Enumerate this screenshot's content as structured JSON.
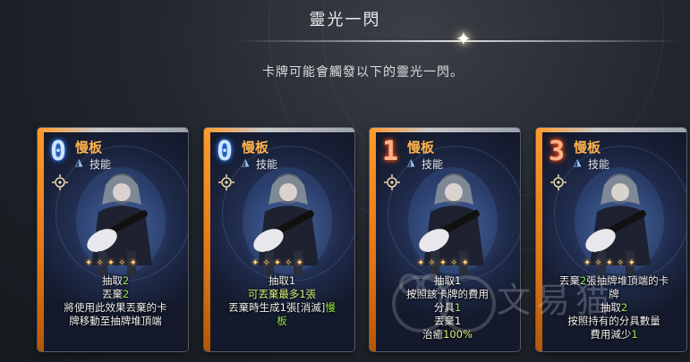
{
  "header": {
    "title": "靈光一閃",
    "subtitle": "卡牌可能會觸發以下的靈光一閃。"
  },
  "cards": [
    {
      "cost": "0",
      "name": "慢板",
      "type": "技能",
      "desc": [
        [
          {
            "t": "抽取"
          },
          {
            "t": "2",
            "h": true
          }
        ],
        [
          {
            "t": "丟棄"
          },
          {
            "t": "2",
            "h": true
          }
        ],
        [
          {
            "t": "將使用此效果丟棄的卡"
          }
        ],
        [
          {
            "t": "牌移動至抽牌堆頂端"
          }
        ]
      ]
    },
    {
      "cost": "0",
      "name": "慢板",
      "type": "技能",
      "desc": [
        [
          {
            "t": "抽取1"
          }
        ],
        [
          {
            "t": "可丟棄最多1張",
            "y": true
          }
        ],
        [
          {
            "t": "丟棄時生成1張[消滅]"
          },
          {
            "t": "慢",
            "h": true
          }
        ],
        [
          {
            "t": "板",
            "h": true
          }
        ]
      ]
    },
    {
      "cost": "1",
      "name": "慢板",
      "type": "技能",
      "desc": [
        [
          {
            "t": "抽取1"
          }
        ],
        [
          {
            "t": "按照該卡牌的費用"
          }
        ],
        [
          {
            "t": "分具"
          },
          {
            "t": "1",
            "h": true
          }
        ],
        [
          {
            "t": "丟棄1"
          }
        ],
        [
          {
            "t": "治癒"
          },
          {
            "t": "100%",
            "y": true
          }
        ]
      ]
    },
    {
      "cost": "3",
      "name": "慢板",
      "type": "技能",
      "desc": [
        [
          {
            "t": "丟棄"
          },
          {
            "t": "2",
            "h": true
          },
          {
            "t": "張抽牌堆頂端的卡"
          }
        ],
        [
          {
            "t": "牌"
          }
        ],
        [
          {
            "t": "抽取"
          },
          {
            "t": "2",
            "h": true
          }
        ],
        [
          {
            "t": "按照持有的分具數量"
          }
        ],
        [
          {
            "t": "費用減少"
          },
          {
            "t": "1",
            "h": true
          }
        ]
      ]
    }
  ],
  "watermark": "文易猫",
  "colors": {
    "accent_orange": "#ff9a2e",
    "card_name": "#ffb14a",
    "highlight_green": "#9be84a",
    "cost_blue_glow": "#3d8bff",
    "cost_red_glow": "#ff5a1a"
  }
}
